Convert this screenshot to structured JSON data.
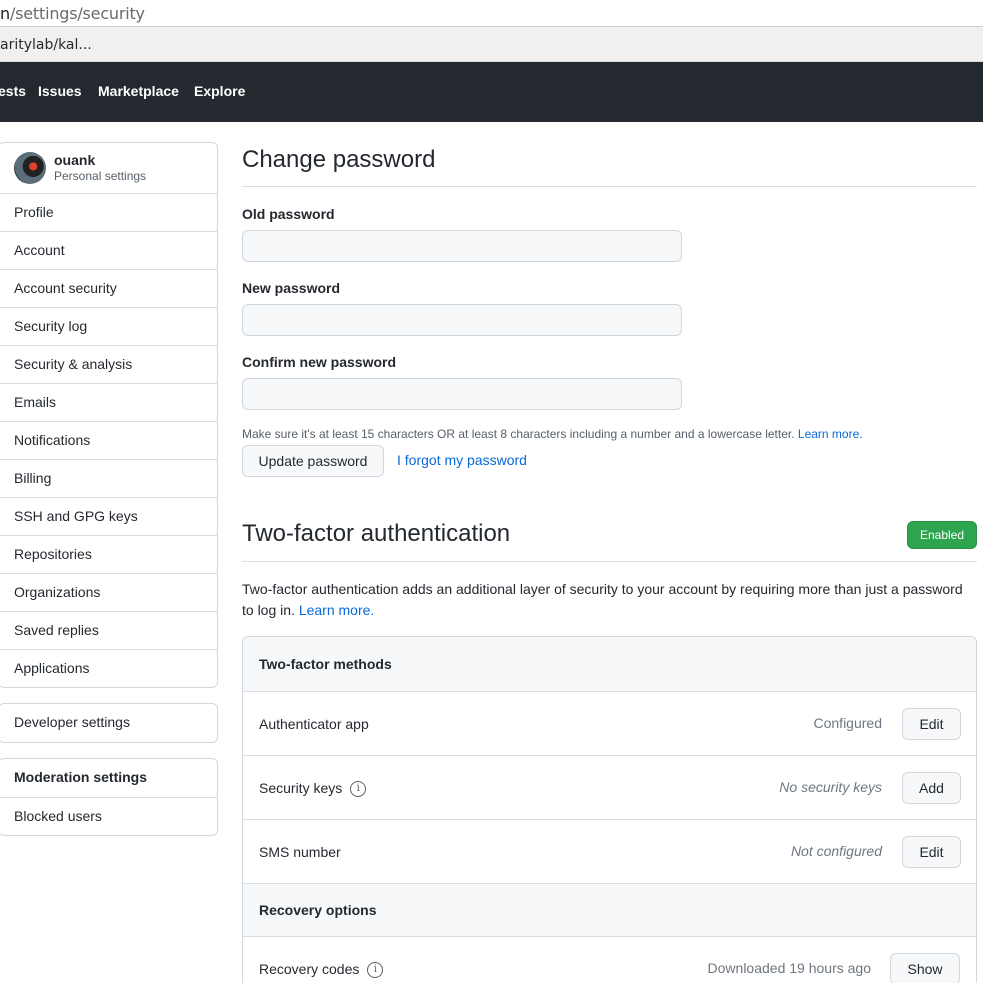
{
  "browser": {
    "url_host": "n",
    "url_path": "/settings/security",
    "bookmark": "aritylab/kal..."
  },
  "header": {
    "nav": [
      "ests",
      "Issues",
      "Marketplace",
      "Explore"
    ]
  },
  "sidebar": {
    "user": {
      "name": "ouank",
      "subtitle": "Personal settings"
    },
    "items": [
      "Profile",
      "Account",
      "Account security",
      "Security log",
      "Security & analysis",
      "Emails",
      "Notifications",
      "Billing",
      "SSH and GPG keys",
      "Repositories",
      "Organizations",
      "Saved replies",
      "Applications"
    ],
    "developer": "Developer settings",
    "moderation": {
      "title": "Moderation settings",
      "items": [
        "Blocked users"
      ]
    }
  },
  "change_password": {
    "title": "Change password",
    "old_label": "Old password",
    "new_label": "New password",
    "confirm_label": "Confirm new password",
    "hint": "Make sure it's at least 15 characters OR at least 8 characters including a number and a lowercase letter.",
    "hint_link": "Learn more.",
    "update_button": "Update password",
    "forgot_link": "I forgot my password"
  },
  "two_factor": {
    "title": "Two-factor authentication",
    "badge": "Enabled",
    "description": "Two-factor authentication adds an additional layer of security to your account by requiring more than just a password to log in.",
    "learn_more": "Learn more.",
    "methods_title": "Two-factor methods",
    "methods": [
      {
        "label": "Authenticator app",
        "status": "Configured",
        "action": "Edit"
      },
      {
        "label": "Security keys",
        "status": "No security keys",
        "action": "Add"
      },
      {
        "label": "SMS number",
        "status": "Not configured",
        "action": "Edit"
      }
    ],
    "recovery_title": "Recovery options",
    "recovery": [
      {
        "label": "Recovery codes",
        "status": "Downloaded 19 hours ago",
        "action": "Show"
      }
    ]
  },
  "colors": {
    "header_bg": "#24292f",
    "link": "#0969da",
    "enabled_badge": "#2da44e"
  }
}
